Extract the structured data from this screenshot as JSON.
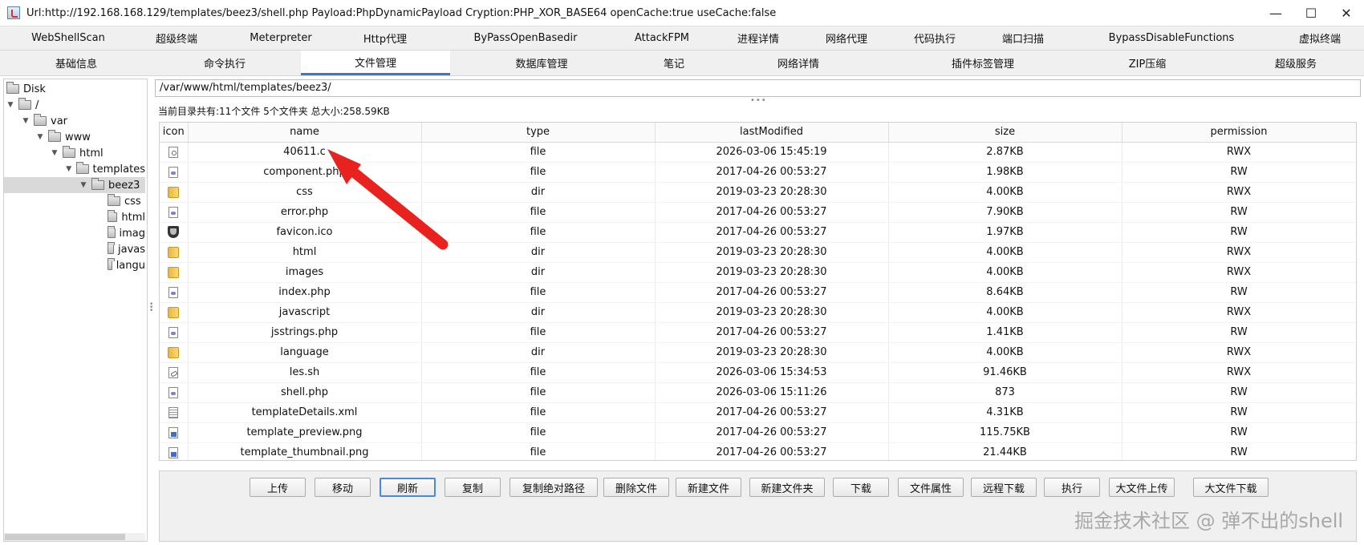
{
  "window": {
    "title": "Url:http://192.168.168.129/templates/beez3/shell.php Payload:PhpDynamicPayload Cryption:PHP_XOR_BASE64 openCache:true useCache:false",
    "controls": {
      "minimize": "—",
      "maximize": "☐",
      "close": "✕"
    }
  },
  "tabs_row1": [
    "WebShellScan",
    "超级终端",
    "Meterpreter",
    "Http代理",
    "ByPassOpenBasedir",
    "AttackFPM",
    "进程详情",
    "网络代理",
    "代码执行",
    "端口扫描",
    "BypassDisableFunctions",
    "虚拟终端"
  ],
  "tabs_row2": [
    "基础信息",
    "命令执行",
    "文件管理",
    "数据库管理",
    "笔记",
    "网络详情",
    "插件标签管理",
    "ZIP压缩",
    "超级服务"
  ],
  "active_tab": "文件管理",
  "tree": [
    {
      "label": "Disk",
      "toggle": ""
    },
    {
      "label": "/",
      "toggle": "▼"
    },
    {
      "label": "var",
      "toggle": "▼"
    },
    {
      "label": "www",
      "toggle": "▼"
    },
    {
      "label": "html",
      "toggle": "▼"
    },
    {
      "label": "templates",
      "toggle": "▼"
    },
    {
      "label": "beez3",
      "toggle": "▼",
      "selected": true
    },
    {
      "label": "css",
      "toggle": ""
    },
    {
      "label": "html",
      "toggle": ""
    },
    {
      "label": "imag",
      "toggle": ""
    },
    {
      "label": "javas",
      "toggle": ""
    },
    {
      "label": "langu",
      "toggle": ""
    }
  ],
  "path": "/var/www/html/templates/beez3/",
  "summary": "当前目录共有:11个文件 5个文件夹 总大小:258.59KB",
  "table": {
    "headers": [
      "icon",
      "name",
      "type",
      "lastModified",
      "size",
      "permission"
    ],
    "rows": [
      {
        "icon": "c-file-icon",
        "name": "40611.c",
        "type": "file",
        "lastModified": "2026-03-06 15:45:19",
        "size": "2.87KB",
        "permission": "RWX"
      },
      {
        "icon": "php-file-icon",
        "name": "component.php",
        "type": "file",
        "lastModified": "2017-04-26 00:53:27",
        "size": "1.98KB",
        "permission": "RW"
      },
      {
        "icon": "folder-icon",
        "name": "css",
        "type": "dir",
        "lastModified": "2019-03-23 20:28:30",
        "size": "4.00KB",
        "permission": "RWX"
      },
      {
        "icon": "php-file-icon",
        "name": "error.php",
        "type": "file",
        "lastModified": "2017-04-26 00:53:27",
        "size": "7.90KB",
        "permission": "RW"
      },
      {
        "icon": "ico-file-icon",
        "name": "favicon.ico",
        "type": "file",
        "lastModified": "2017-04-26 00:53:27",
        "size": "1.97KB",
        "permission": "RW"
      },
      {
        "icon": "folder-icon",
        "name": "html",
        "type": "dir",
        "lastModified": "2019-03-23 20:28:30",
        "size": "4.00KB",
        "permission": "RWX"
      },
      {
        "icon": "folder-icon",
        "name": "images",
        "type": "dir",
        "lastModified": "2019-03-23 20:28:30",
        "size": "4.00KB",
        "permission": "RWX"
      },
      {
        "icon": "php-file-icon",
        "name": "index.php",
        "type": "file",
        "lastModified": "2017-04-26 00:53:27",
        "size": "8.64KB",
        "permission": "RW"
      },
      {
        "icon": "folder-icon",
        "name": "javascript",
        "type": "dir",
        "lastModified": "2019-03-23 20:28:30",
        "size": "4.00KB",
        "permission": "RWX"
      },
      {
        "icon": "php-file-icon",
        "name": "jsstrings.php",
        "type": "file",
        "lastModified": "2017-04-26 00:53:27",
        "size": "1.41KB",
        "permission": "RW"
      },
      {
        "icon": "folder-icon",
        "name": "language",
        "type": "dir",
        "lastModified": "2019-03-23 20:28:30",
        "size": "4.00KB",
        "permission": "RWX"
      },
      {
        "icon": "sh-file-icon",
        "name": "les.sh",
        "type": "file",
        "lastModified": "2026-03-06 15:34:53",
        "size": "91.46KB",
        "permission": "RWX"
      },
      {
        "icon": "php-file-icon",
        "name": "shell.php",
        "type": "file",
        "lastModified": "2026-03-06 15:11:26",
        "size": "873",
        "permission": "RW"
      },
      {
        "icon": "xml-file-icon",
        "name": "templateDetails.xml",
        "type": "file",
        "lastModified": "2017-04-26 00:53:27",
        "size": "4.31KB",
        "permission": "RW"
      },
      {
        "icon": "png-file-icon",
        "name": "template_preview.png",
        "type": "file",
        "lastModified": "2017-04-26 00:53:27",
        "size": "115.75KB",
        "permission": "RW"
      },
      {
        "icon": "png-file-icon",
        "name": "template_thumbnail.png",
        "type": "file",
        "lastModified": "2017-04-26 00:53:27",
        "size": "21.44KB",
        "permission": "RW"
      }
    ]
  },
  "buttons": [
    "上传",
    "移动",
    "刷新",
    "复制",
    "复制绝对路径",
    "删除文件",
    "新建文件",
    "新建文件夹",
    "下载",
    "文件属性",
    "远程下载",
    "执行",
    "大文件上传",
    "大文件下载"
  ],
  "focused_button": "刷新",
  "annotation_color": "#e8231f",
  "watermark": "掘金技术社区 @ 弹不出的shell"
}
